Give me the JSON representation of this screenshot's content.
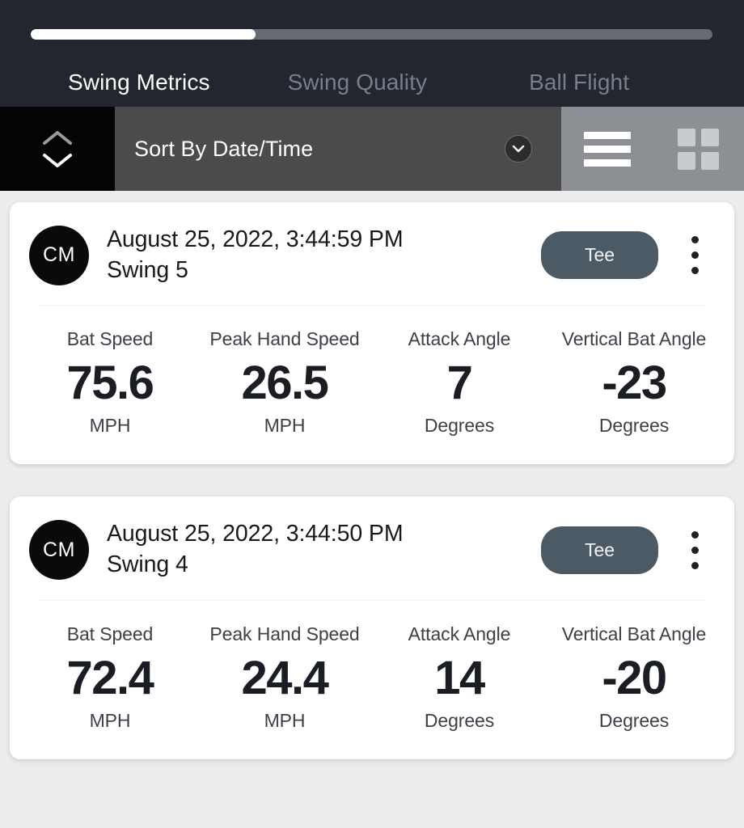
{
  "header": {
    "progress": {
      "percent": 33,
      "label": "33%"
    },
    "tabs": [
      {
        "label": "Swing Metrics",
        "active": true
      },
      {
        "label": "Swing Quality",
        "active": false
      },
      {
        "label": "Ball Flight",
        "active": false
      }
    ]
  },
  "toolbar": {
    "sort_order_icon": "chevron-up-down-icon",
    "sort_label": "Sort By Date/Time",
    "dropdown_icon": "chevron-down-icon",
    "list_view_icon": "list-view-icon",
    "grid_view_icon": "grid-view-icon",
    "active_view": "list"
  },
  "colors": {
    "header_bg": "#22262f",
    "toolbar_sort_bg": "#4b4b4d",
    "toolbar_view_bg": "#8c8f94",
    "page_bg": "#ececec",
    "card_bg": "#ffffff",
    "badge_bg": "#4b5a64",
    "avatar_bg": "#0a0a0a",
    "text_primary": "#1a1d23",
    "text_muted": "#787f8c"
  },
  "cards": [
    {
      "avatar_initials": "CM",
      "datetime": "August 25, 2022, 3:44:59 PM",
      "swing": "Swing 5",
      "badge": "Tee",
      "menu_icon": "kebab-menu-icon",
      "metrics": [
        {
          "label": "Bat Speed",
          "value": "75.6",
          "unit": "MPH"
        },
        {
          "label": "Peak Hand Speed",
          "value": "26.5",
          "unit": "MPH"
        },
        {
          "label": "Attack Angle",
          "value": "7",
          "unit": "Degrees"
        },
        {
          "label": "Vertical Bat Angle",
          "value": "-23",
          "unit": "Degrees"
        }
      ]
    },
    {
      "avatar_initials": "CM",
      "datetime": "August 25, 2022, 3:44:50 PM",
      "swing": "Swing 4",
      "badge": "Tee",
      "menu_icon": "kebab-menu-icon",
      "metrics": [
        {
          "label": "Bat Speed",
          "value": "72.4",
          "unit": "MPH"
        },
        {
          "label": "Peak Hand Speed",
          "value": "24.4",
          "unit": "MPH"
        },
        {
          "label": "Attack Angle",
          "value": "14",
          "unit": "Degrees"
        },
        {
          "label": "Vertical Bat Angle",
          "value": "-20",
          "unit": "Degrees"
        }
      ]
    }
  ]
}
